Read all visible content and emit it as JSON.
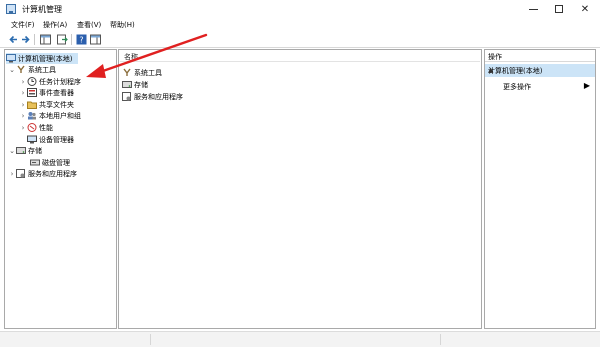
{
  "window": {
    "title": "计算机管理"
  },
  "menu": [
    "文件(F)",
    "操作(A)",
    "查看(V)",
    "帮助(H)"
  ],
  "tree": {
    "root": "计算机管理(本地)",
    "system_tools": "系统工具",
    "children": [
      "任务计划程序",
      "事件查看器",
      "共享文件夹",
      "本地用户和组",
      "性能",
      "设备管理器"
    ],
    "storage": "存储",
    "disk_mgmt": "磁盘管理",
    "services": "服务和应用程序"
  },
  "list": {
    "column": "名称",
    "items": [
      "系统工具",
      "存储",
      "服务和应用程序"
    ]
  },
  "actions": {
    "title": "操作",
    "section": "计算机管理(本地)",
    "more": "更多操作"
  },
  "annotation_color": "#e02020"
}
